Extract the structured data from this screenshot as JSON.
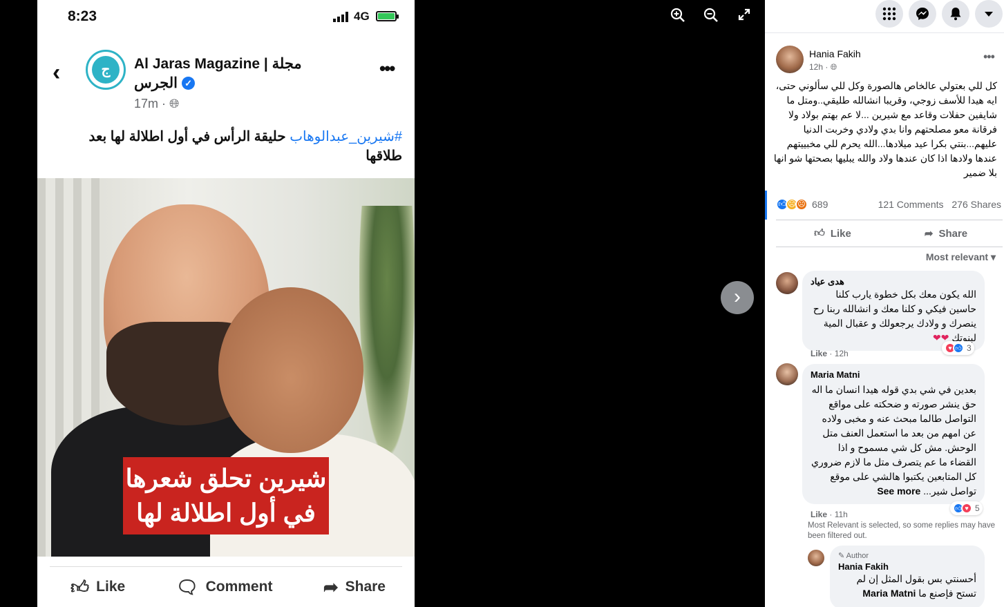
{
  "phone": {
    "time": "8:23",
    "network": "4G",
    "page_name_line1": "Al Jaras Magazine | مجلة",
    "page_name_line2": "الجرس",
    "page_logo_text": "ج",
    "post_time": "17m · ",
    "caption_hashtag": "#شيرين_عبدالوهاب",
    "caption_text": " حليقة الرأس في أول اطلالة لها بعد طلاقها",
    "overlay_line1": "شيرين تحلق شعرها",
    "overlay_line2": "في أول اطلالة لها",
    "actions": {
      "like": "Like",
      "comment": "Comment",
      "share": "Share"
    }
  },
  "viewer": {
    "zoom_in_icon": "zoom-in-icon",
    "zoom_out_icon": "zoom-out-icon",
    "fullscreen_icon": "fullscreen-icon",
    "next_icon": "chevron-right-icon"
  },
  "topbar": {
    "icons": [
      "menu-grid-icon",
      "messenger-icon",
      "notifications-icon",
      "account-dropdown-icon"
    ]
  },
  "post": {
    "author": "Hania Fakih",
    "time": "12h · ",
    "text": "كل للي بعتولي عالخاص هالصورة وكل للي سألوني حتى، ايه هيدا للأسف زوجي، وقريبا انشالله طليقي..ومتل ما شايفين حفلات وقاعد مع شيرين ...لا عم بهتم بولاد ولا فرقانة معو مصلحتهم وانا بدي ولادي وخربت الدنيا عليهم...بنتي بكرا عيد ميلادها...الله يحرم للي مخبييتهم عندها ولادها اذا كان عندها ولاد والله يبليها بصحتها شو انها بلا ضمير",
    "reaction_count": "689",
    "comments": "121 Comments",
    "shares": "276 Shares",
    "like_label": "Like",
    "share_label": "Share",
    "sort_label": "Most relevant"
  },
  "comments": [
    {
      "name": "هدى عياد",
      "text": "الله يكون معك بكل خطوة يارب كلنا حاسين فيكي و كلنا معك و انشالله ربنا رح ينصرك و ولادك يرجعولك و عقبال المية لبنوتك",
      "emoji": "❤❤",
      "reactions": "3",
      "like": "Like",
      "time": "12h"
    },
    {
      "name": "Maria Matni",
      "text": "بعدين في شي بدي قوله هيدا انسان ما اله حق ينشر صورته و ضحكته على مواقع التواصل طالما مبحث عنه و مخبى ولاده عن امهم من بعد ما استعمل العنف متل الوحش. مش كل شي مسموح و اذا القضاء ما عم يتصرف متل ما لازم ضروري كل المتابعين يكتبوا هالشي على موقع تواصل شير...",
      "see_more": "See more",
      "reactions": "5",
      "like": "Like",
      "time": "11h"
    }
  ],
  "filter_note": "Most Relevant is selected, so some replies may have been filtered out.",
  "reply": {
    "badge": "Author",
    "name": "Hania Fakih",
    "mention": "Maria Matni",
    "text": "أحسنتي بس بقول المثل إن لم تستح فإصنع ما"
  }
}
